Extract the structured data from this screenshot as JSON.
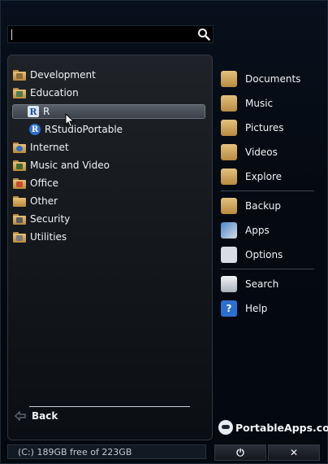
{
  "search": {
    "value": "",
    "placeholder": ""
  },
  "categories": [
    {
      "label": "Development",
      "icon": "development-folder-icon"
    },
    {
      "label": "Education",
      "icon": "education-folder-icon"
    },
    {
      "label": "R",
      "icon": "r-app-icon",
      "selected": true
    },
    {
      "label": "RStudioPortable",
      "icon": "rstudio-app-icon"
    },
    {
      "label": "Internet",
      "icon": "internet-folder-icon"
    },
    {
      "label": "Music and Video",
      "icon": "music-video-folder-icon"
    },
    {
      "label": "Office",
      "icon": "office-folder-icon"
    },
    {
      "label": "Other",
      "icon": "other-folder-icon"
    },
    {
      "label": "Security",
      "icon": "security-folder-icon"
    },
    {
      "label": "Utilities",
      "icon": "utilities-folder-icon"
    }
  ],
  "back": {
    "label": "Back"
  },
  "right_menu": [
    {
      "label": "Documents",
      "icon": "documents-icon"
    },
    {
      "label": "Music",
      "icon": "music-icon"
    },
    {
      "label": "Pictures",
      "icon": "pictures-icon"
    },
    {
      "label": "Videos",
      "icon": "videos-icon"
    },
    {
      "label": "Explore",
      "icon": "explore-icon"
    },
    {
      "label": "Backup",
      "icon": "backup-icon"
    },
    {
      "label": "Apps",
      "icon": "apps-icon"
    },
    {
      "label": "Options",
      "icon": "options-icon"
    },
    {
      "label": "Search",
      "icon": "search-icon"
    },
    {
      "label": "Help",
      "icon": "help-icon"
    }
  ],
  "logo": {
    "text": "PortableApps.com"
  },
  "status": {
    "text": "(C:) 189GB free of 223GB"
  },
  "buttons": {
    "power": "⏻",
    "close": "✕"
  },
  "colors": {
    "selection": "#4f5760",
    "folder": "#d9b266",
    "help": "#2c6fd1"
  }
}
